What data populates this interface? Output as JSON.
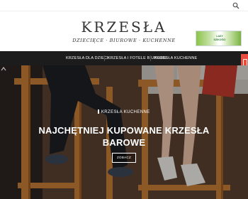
{
  "site": {
    "logo": "KRZESŁA",
    "tagline": "DZIECIĘCE · BIUROWE · KUCHENNE"
  },
  "ad": {
    "text": "LASY DZIKOŚCI"
  },
  "nav": {
    "items": [
      {
        "label": "KRZESŁA DLA DZIECI"
      },
      {
        "label": "KRZESŁA I FOTELE BIUROWE"
      },
      {
        "label": "KRZESŁA KUCHENNE"
      }
    ]
  },
  "hero": {
    "category": "KRZESŁA KUCHENNE",
    "title": "NAJCHĘTNIEJ KUPOWANE KRZESŁA BAROWE",
    "button_label": "ZOBACZ"
  },
  "icons": {
    "search": "search-icon",
    "side_tab": "side-tab-icon",
    "scroll_top": "arrow-up-icon"
  },
  "colors": {
    "nav_background": "#1c1c1c",
    "accent": "#e74c3c"
  }
}
